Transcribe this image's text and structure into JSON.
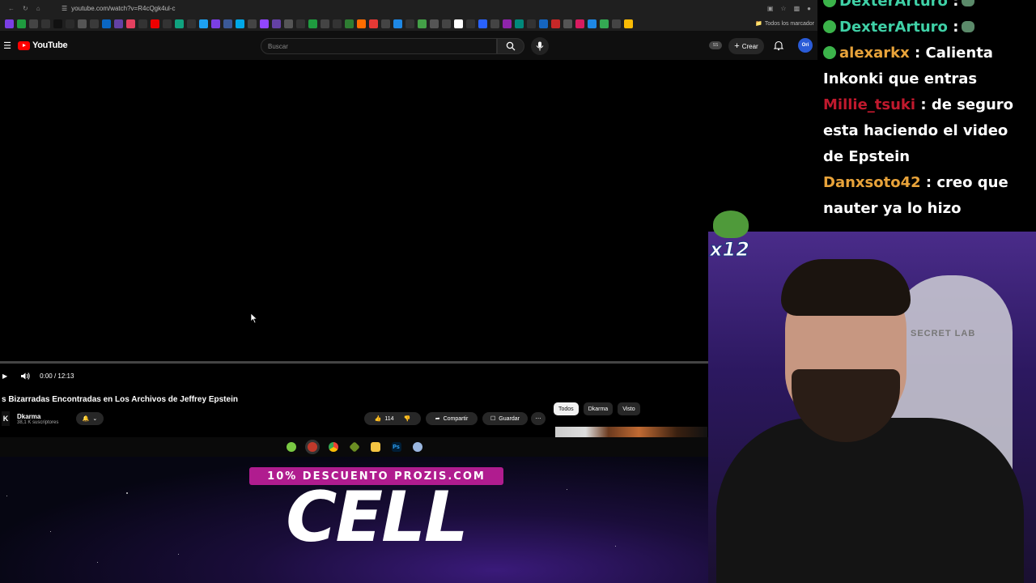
{
  "browser": {
    "url": "youtube.com/watch?v=R4cQgk4ul-c",
    "bookmarks_all_label": "Todos los marcador"
  },
  "youtube": {
    "logo_text": "YouTube",
    "search": {
      "placeholder": "Buscar"
    },
    "ss_badge": "SS",
    "create_label": "Crear",
    "avatar_text": "Ori"
  },
  "player": {
    "time": "0:00 / 12:13",
    "progress": 0
  },
  "video": {
    "title": "s Bizarradas Encontradas en Los Archivos de Jeffrey Epstein",
    "channel_initial": "K",
    "channel_name": "Dkarma",
    "subscribers": "38,1 K suscriptores",
    "likes": "114",
    "share_label": "Compartir",
    "save_label": "Guardar",
    "chips": [
      "Todos",
      "Dkarma",
      "Visto"
    ]
  },
  "overlay": {
    "promo_banner": "10% DESCUENTO PROZIS.COM",
    "promo_big": "CELL"
  },
  "chat": {
    "messages": [
      {
        "user": "DexterArturo",
        "sep": " :",
        "text": "",
        "color": "#3fd0a6"
      },
      {
        "user": "DexterArturo",
        "sep": " :",
        "text": "",
        "color": "#3fd0a6"
      },
      {
        "user": "alexarkx",
        "sep": " :",
        "text": " Calienta Inkonki que entras",
        "color": "#e8a33a"
      },
      {
        "user": "Millie_tsuki",
        "sep": " :",
        "text": " de seguro esta haciendo el video de Epstein",
        "color": "#c0192d"
      },
      {
        "user": "Danxsoto42",
        "sep": " :",
        "text": " creo que nauter ya lo hizo",
        "color": "#e8a33a"
      }
    ]
  },
  "webcam": {
    "chair_text": "SECRET LAB",
    "emote_count": "x12"
  }
}
